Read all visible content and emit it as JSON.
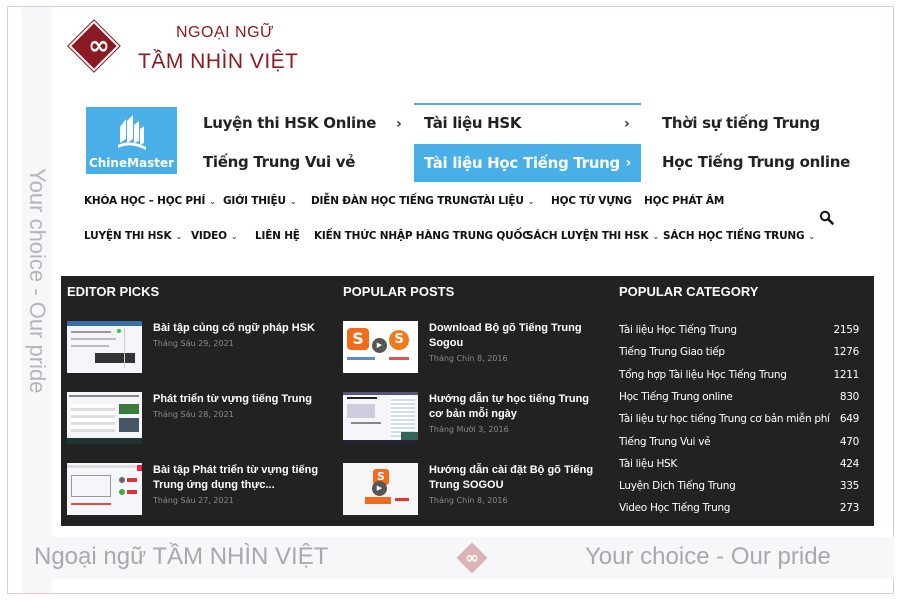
{
  "brand": {
    "line1": "NGOẠI NGỮ",
    "line2": "TẦM NHÌN VIỆT",
    "icon": "infinity-diamond-logo",
    "color": "#8b1a22"
  },
  "side_tagline": "Your choice - Our pride",
  "chinemaster_logo": {
    "text": "ChineMaster",
    "color": "#4aafe6"
  },
  "top_links": {
    "col1": [
      "Luyện thi HSK Online",
      "Tiếng Trung Vui vẻ"
    ],
    "col2": [
      "Tài liệu HSK",
      "Tài liệu Học Tiếng Trung"
    ],
    "col3": [
      "Thời sự tiếng Trung",
      "Học Tiếng Trung online"
    ],
    "chevron": "›",
    "active_index": 1,
    "accent_color": "#4aafe6"
  },
  "menu": {
    "row1": [
      {
        "label": "KHÓA HỌC – HỌC PHÍ",
        "dropdown": "⌄"
      },
      {
        "label": "GIỚI THIỆU",
        "dropdown": "⌄"
      },
      {
        "label": "DIỄN ĐÀN HỌC TIẾNG TRUNG",
        "dropdown": null
      },
      {
        "label": "TÀI LIỆU",
        "dropdown": "⌄"
      },
      {
        "label": "HỌC TỪ VỰNG",
        "dropdown": null
      },
      {
        "label": "HỌC PHÁT ÂM",
        "dropdown": null
      }
    ],
    "row2": [
      {
        "label": "LUYỆN THI HSK",
        "dropdown": "⌄"
      },
      {
        "label": "VIDEO",
        "dropdown": "⌄"
      },
      {
        "label": "LIÊN HỆ",
        "dropdown": null
      },
      {
        "label": "KIẾN THỨC NHẬP HÀNG TRUNG QUỐC",
        "dropdown": null
      },
      {
        "label": "SÁCH LUYỆN THI HSK",
        "dropdown": "⌄"
      },
      {
        "label": "SÁCH HỌC TIẾNG TRUNG",
        "dropdown": "⌄"
      }
    ],
    "search_icon": "search-icon"
  },
  "editor_picks": {
    "title": "EDITOR PICKS",
    "posts": [
      {
        "title": "Bài tập củng cố ngữ pháp HSK",
        "date": "Tháng Sáu 29, 2021"
      },
      {
        "title": "Phát triển từ vựng tiếng Trung",
        "date": "Tháng Sáu 28, 2021"
      },
      {
        "title": "Bài tập Phát triển từ vựng tiếng Trung ứng dụng thực...",
        "date": "Tháng Sáu 27, 2021"
      }
    ]
  },
  "popular_posts": {
    "title": "POPULAR POSTS",
    "posts": [
      {
        "title": "Download Bộ gõ Tiếng Trung Sogou",
        "date": "Tháng Chín 8, 2016"
      },
      {
        "title": "Hướng dẫn tự học tiếng Trung cơ bản mỗi ngày",
        "date": "Tháng Mười 3, 2016"
      },
      {
        "title": "Hướng dẫn cài đặt Bộ gõ Tiếng Trung SOGOU",
        "date": "Tháng Chín 8, 2016"
      }
    ]
  },
  "popular_category": {
    "title": "POPULAR CATEGORY",
    "items": [
      {
        "name": "Tài liệu Học Tiếng Trung",
        "count": "2159"
      },
      {
        "name": "Tiếng Trung Giao tiếp",
        "count": "1276"
      },
      {
        "name": "Tổng hợp Tài liệu Học Tiếng Trung",
        "count": "1211"
      },
      {
        "name": "Học Tiếng Trung online",
        "count": "830"
      },
      {
        "name": "Tài liệu tự học tiếng Trung cơ bản miễn phí",
        "count": "649"
      },
      {
        "name": "Tiếng Trung Vui vẻ",
        "count": "470"
      },
      {
        "name": "Tài liệu HSK",
        "count": "424"
      },
      {
        "name": "Luyện Dịch Tiếng Trung",
        "count": "335"
      },
      {
        "name": "Video Học Tiếng Trung",
        "count": "273"
      }
    ]
  },
  "footer": {
    "left_prefix": "Ngoại ngữ ",
    "left_brand": "TẦM NHÌN VIỆT",
    "right": "Your choice - Our pride",
    "infinity": "∞"
  },
  "icons": {
    "infinity": "∞",
    "play": "▶"
  }
}
